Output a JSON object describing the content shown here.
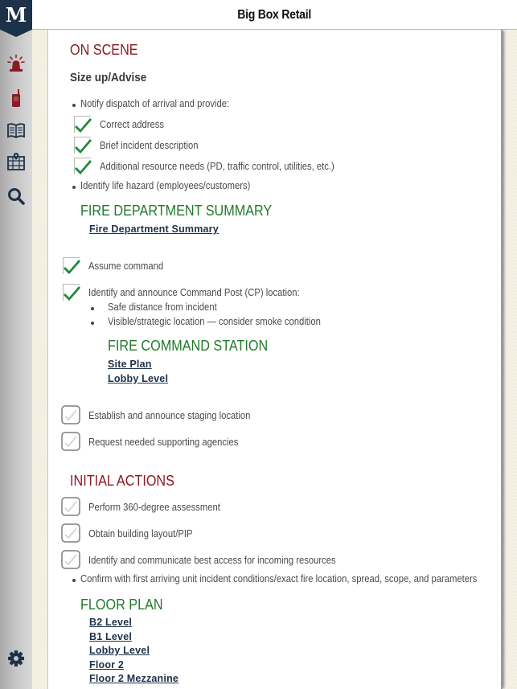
{
  "sidebar": {
    "logo": "M",
    "items": [
      {
        "icon": "siren-icon",
        "label": "Alerts"
      },
      {
        "icon": "radio-icon",
        "label": "Radio"
      },
      {
        "icon": "book-icon",
        "label": "Guide"
      },
      {
        "icon": "map-icon",
        "label": "Map"
      },
      {
        "icon": "search-icon",
        "label": "Search"
      }
    ],
    "settings_icon": "gear-icon"
  },
  "header": {
    "title": "Big Box Retail"
  },
  "colors": {
    "section_red": "#8b1a24",
    "section_green": "#217a2b",
    "link_navy": "#1d3148",
    "check_green": "#1e8a3a"
  },
  "on_scene": {
    "title": "ON SCENE",
    "subtitle": "Size up/Advise",
    "notify": "Notify dispatch of arrival and provide:",
    "notify_checks": [
      {
        "label": "Correct address",
        "checked": true
      },
      {
        "label": "Brief incident description",
        "checked": true
      },
      {
        "label": "Additional resource needs (PD, traffic control, utilities, etc.)",
        "checked": true
      }
    ],
    "life_hazard": "Identify life hazard (employees/customers)",
    "fds_title": "FIRE DEPARTMENT SUMMARY",
    "fds_link": "Fire Department Summary",
    "command_checks": [
      {
        "label": "Assume command",
        "checked": true
      },
      {
        "label": "Identify and announce Command Post (CP) location:",
        "checked": true
      }
    ],
    "cp_bullets": [
      "Safe distance from incident",
      "Visible/strategic location — consider smoke condition"
    ],
    "fcs_title": "FIRE COMMAND STATION",
    "fcs_links": [
      "Site Plan",
      "Lobby Level"
    ],
    "staging_checks": [
      {
        "label": "Establish and announce staging location",
        "checked": false
      },
      {
        "label": "Request needed supporting agencies",
        "checked": false
      }
    ]
  },
  "initial_actions": {
    "title": "INITIAL ACTIONS",
    "checks": [
      {
        "label": "Perform 360-degree assessment",
        "checked": false
      },
      {
        "label": "Obtain building layout/PIP",
        "checked": false
      },
      {
        "label": "Identify and communicate best access for incoming resources",
        "checked": false
      }
    ],
    "confirm": "Confirm with first arriving unit incident conditions/exact fire location, spread, scope, and parameters",
    "floor_plan_title": "FLOOR PLAN",
    "floor_links": [
      "B2 Level",
      "B1 Level",
      "Lobby Level",
      "Floor 2",
      "Floor 2 Mezzanine"
    ]
  }
}
